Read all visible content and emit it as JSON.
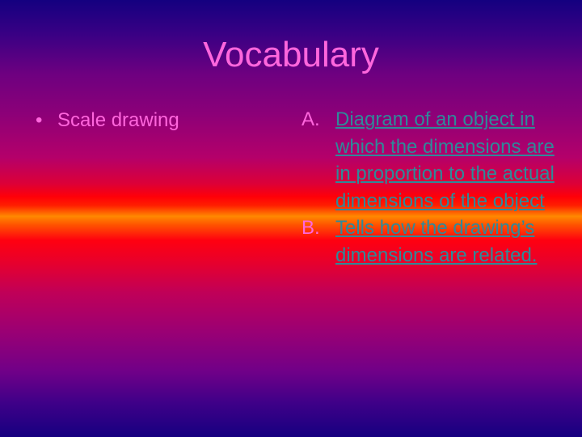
{
  "slide": {
    "title": "Vocabulary",
    "term": {
      "bullet": "•",
      "text": "Scale drawing"
    },
    "definitions": [
      {
        "marker": "A.",
        "text": "Diagram of an object in which the dimensions are in proportion to the actual dimensions of the object"
      },
      {
        "marker": "B.",
        "text": "Tells how the drawing’s dimensions are related."
      }
    ],
    "colors": {
      "text": "#ff66dd",
      "link": "#2e8a9a",
      "gradient_top": "#140080",
      "gradient_middle": "#ff8800",
      "gradient_bottom": "#160080"
    }
  }
}
